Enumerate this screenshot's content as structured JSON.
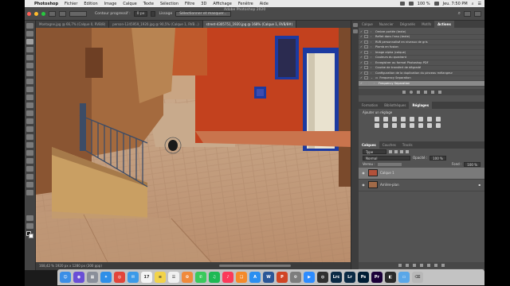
{
  "menubar": {
    "app_name": "Photoshop",
    "items": [
      "Fichier",
      "Edition",
      "Image",
      "Calque",
      "Texte",
      "Sélection",
      "Filtre",
      "3D",
      "Affichage",
      "Fenêtre",
      "Aide"
    ],
    "battery": "100 %",
    "clock": "Jeu. 7:50 PM"
  },
  "window": {
    "title": "Adobe Photoshop 2020"
  },
  "options": {
    "contour_label": "Contour progressif :",
    "contour_value": "0 px",
    "lissage_label": "Lissage",
    "select_mask_button": "Sélectionner et masquer..."
  },
  "tabs": [
    {
      "label": "Montagne.jpg @ 66,7% (Calque 0, RVB/8)",
      "active": false
    },
    {
      "label": "person-1245959_1920.jpg @ 90,5% (Calque 1, RVB...)",
      "active": false
    },
    {
      "label": "street-4305751_1920.jpg @ 168% (Calque 1, RVB/8#)",
      "active": true
    }
  ],
  "status_bar": {
    "text": "168,42 %    1920 px x 1280 px (300 ppp)"
  },
  "actions_panel": {
    "tabs": [
      "Calque",
      "Nuancier",
      "Dégradés",
      "Motifs",
      "Actions"
    ],
    "active_tab": "Actions",
    "items": [
      {
        "label": "Ombre portée (texte)",
        "type": "action",
        "highlighted": false
      },
      {
        "label": "Reflet dans l'eau (texte)",
        "type": "action",
        "highlighted": false
      },
      {
        "label": "RVB personnalisé en niveaux de gris",
        "type": "action",
        "highlighted": false
      },
      {
        "label": "Plomb en fusion",
        "type": "action",
        "highlighted": false
      },
      {
        "label": "Image alpha (calque)",
        "type": "action",
        "highlighted": false
      },
      {
        "label": "Couleurs du quadrant",
        "type": "action",
        "highlighted": false
      },
      {
        "label": "Enregistrer au format Photoshop PDF",
        "type": "action",
        "highlighted": false
      },
      {
        "label": "Courbe de transfert de dégradé",
        "type": "action",
        "highlighted": false
      },
      {
        "label": "Configuration de la duplication du pinceau mélangeur",
        "type": "action",
        "highlighted": false
      },
      {
        "label": "Frequency Separation",
        "type": "set",
        "highlighted": false
      },
      {
        "label": "Frequency Separation",
        "type": "action",
        "highlighted": true
      }
    ]
  },
  "adjustments_panel": {
    "tabs": [
      "Formation",
      "Bibliothèques",
      "Réglages"
    ],
    "active_tab": "Réglages",
    "add_label": "Ajouter un réglage"
  },
  "layers_panel": {
    "tabs": [
      "Calques",
      "Couches",
      "Tracés"
    ],
    "active_tab": "Calques",
    "filter_label": "Type",
    "blend_mode": "Normal",
    "opacity_label": "Opacité :",
    "opacity_value": "100 %",
    "lock_label": "Verrou :",
    "fill_label": "Fond :",
    "fill_value": "100 %",
    "layers": [
      {
        "name": "Calque 1",
        "selected": true,
        "thumb_color": "#b2513a"
      },
      {
        "name": "Arrière-plan",
        "selected": false,
        "thumb_color": "#a06a48",
        "locked": true
      }
    ]
  },
  "dock": {
    "apps": [
      {
        "name": "finder-icon",
        "color": "#3b8ee6",
        "glyph": "☺"
      },
      {
        "name": "siri-icon",
        "color": "#6a4fd6",
        "glyph": "◉"
      },
      {
        "name": "launchpad-icon",
        "color": "#8a8f9a",
        "glyph": "▦"
      },
      {
        "name": "safari-icon",
        "color": "#2e8fe8",
        "glyph": "✦"
      },
      {
        "name": "chrome-icon",
        "color": "#e2453a",
        "glyph": "◎"
      },
      {
        "name": "mail-icon",
        "color": "#3b9ae8",
        "glyph": "✉"
      },
      {
        "name": "calendar-icon",
        "color": "#f4f4f4",
        "glyph": "17"
      },
      {
        "name": "notes-icon",
        "color": "#f2d34a",
        "glyph": "≡"
      },
      {
        "name": "reminders-icon",
        "color": "#f0f0f0",
        "glyph": "☰"
      },
      {
        "name": "photos-icon",
        "color": "#f08a3c",
        "glyph": "✿"
      },
      {
        "name": "messages-icon",
        "color": "#3ac95c",
        "glyph": "✆"
      },
      {
        "name": "spotify-icon",
        "color": "#1db954",
        "glyph": "♫"
      },
      {
        "name": "music-icon",
        "color": "#fb3a5a",
        "glyph": "♪"
      },
      {
        "name": "books-icon",
        "color": "#f58a2a",
        "glyph": "❏"
      },
      {
        "name": "appstore-icon",
        "color": "#2b8ff0",
        "glyph": "A"
      },
      {
        "name": "word-icon",
        "color": "#2b5797",
        "glyph": "W"
      },
      {
        "name": "powerpoint-icon",
        "color": "#d14524",
        "glyph": "P"
      },
      {
        "name": "preferences-icon",
        "color": "#7d7d7d",
        "glyph": "⚙"
      },
      {
        "name": "zoom-icon",
        "color": "#2d8cff",
        "glyph": "▶"
      },
      {
        "name": "camera-icon",
        "color": "#303030",
        "glyph": "◍"
      },
      {
        "name": "lightroom-classic-icon",
        "color": "#0a2a44",
        "glyph": "Lrc"
      },
      {
        "name": "lightroom-icon",
        "color": "#0a2a44",
        "glyph": "Lr"
      },
      {
        "name": "photoshop-icon",
        "color": "#001d34",
        "glyph": "Ps"
      },
      {
        "name": "premiere-icon",
        "color": "#1b0038",
        "glyph": "Pr"
      },
      {
        "name": "capture-icon",
        "color": "#2a2a2a",
        "glyph": "◧"
      },
      {
        "name": "folder-icon",
        "color": "#5aa7e8",
        "glyph": "▭"
      },
      {
        "name": "trash-icon",
        "color": "#b8b8b8",
        "glyph": "⌫"
      }
    ]
  }
}
